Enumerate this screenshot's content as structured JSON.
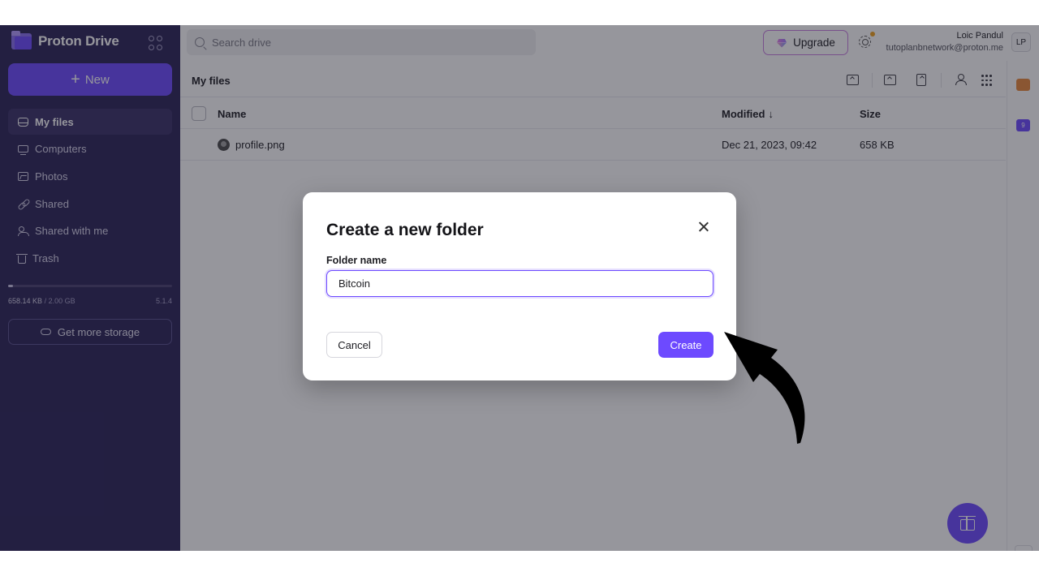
{
  "app": {
    "name": "Proton Drive"
  },
  "sidebar": {
    "new_label": "New",
    "items": [
      {
        "label": "My files",
        "icon": "drive-icon",
        "active": true
      },
      {
        "label": "Computers",
        "icon": "computer-icon"
      },
      {
        "label": "Photos",
        "icon": "photo-icon"
      },
      {
        "label": "Shared",
        "icon": "link-icon"
      },
      {
        "label": "Shared with me",
        "icon": "users-icon"
      },
      {
        "label": "Trash",
        "icon": "trash-icon"
      }
    ],
    "storage_used": "658.14 KB",
    "storage_total": "/ 2.00 GB",
    "storage_fraction": 0.0003,
    "version": "5.1.4",
    "more_storage_label": "Get more storage"
  },
  "header": {
    "search_placeholder": "Search drive",
    "upgrade_label": "Upgrade",
    "user_name": "Loic Pandul",
    "user_email": "tutoplanbnetwork@proton.me",
    "avatar_initials": "LP"
  },
  "files": {
    "breadcrumb": "My files",
    "columns": {
      "name": "Name",
      "modified": "Modified",
      "sort_arrow": "↓",
      "size": "Size"
    },
    "rows": [
      {
        "name": "profile.png",
        "modified": "Dec 21, 2023, 09:42",
        "size": "658 KB"
      }
    ]
  },
  "rail": {
    "badge": "9",
    "collapse": "»"
  },
  "dialog": {
    "title": "Create a new folder",
    "field_label": "Folder name",
    "field_value": "Bitcoin",
    "cancel_label": "Cancel",
    "create_label": "Create"
  },
  "colors": {
    "brand": "#6d4aff",
    "sidebar": "#2b2358"
  }
}
